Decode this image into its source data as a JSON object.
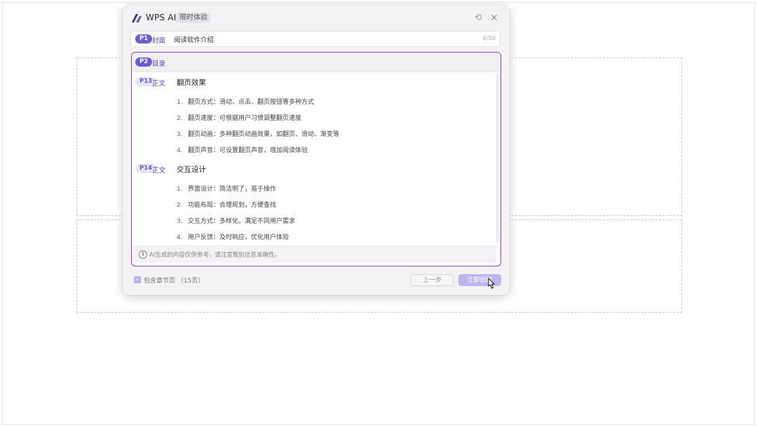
{
  "app": {
    "title": "WPS AI",
    "badge": "限时体验",
    "accent_color": "#6a5ad8",
    "border_color": "#8a3fd6"
  },
  "header_icons": [
    "refresh-icon",
    "close-icon"
  ],
  "cover": {
    "page_badge": "P1",
    "label": "封面",
    "title_value": "阅读软件介绍",
    "char_count": "6/50"
  },
  "outline": {
    "toc": {
      "page_badge": "P2",
      "label": "目录"
    },
    "sections": [
      {
        "page_badge": "P13",
        "label": "正文",
        "title": "翻页效果",
        "items": [
          {
            "num": "1.",
            "text": "翻页方式：滑动、点击、翻页按钮等多种方式"
          },
          {
            "num": "2.",
            "text": "翻页速度：可根据用户习惯调整翻页速度"
          },
          {
            "num": "3.",
            "text": "翻页动画：多种翻页动画效果，如翻页、滑动、渐变等"
          },
          {
            "num": "4.",
            "text": "翻页声音：可设置翻页声音，增加阅读体验"
          }
        ]
      },
      {
        "page_badge": "P14",
        "label": "正文",
        "title": "交互设计",
        "items": [
          {
            "num": "1.",
            "text": "界面设计：简洁明了，易于操作"
          },
          {
            "num": "2.",
            "text": "功能布局：合理规划，方便查找"
          },
          {
            "num": "3.",
            "text": "交互方式：多样化，满足不同用户需求"
          },
          {
            "num": "4.",
            "text": "用户反馈：及时响应，优化用户体验"
          }
        ]
      }
    ],
    "notice": "AI生成的内容仅供参考，请注意甄别信息准确性。"
  },
  "footer": {
    "checkbox_label": "包含章节页",
    "page_count": "（15页）",
    "checked": true,
    "prev_button": "上一步",
    "generate_button": "立即创建"
  }
}
